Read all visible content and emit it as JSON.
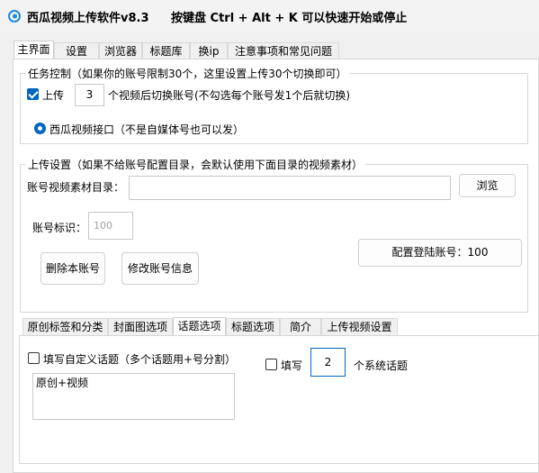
{
  "window": {
    "title": "西瓜视频上传软件v8.3",
    "hotkey_hint": "按键盘 Ctrl + Alt + K  可以快速开始或停止"
  },
  "main_tabs": [
    "主界面",
    "设置",
    "浏览器",
    "标题库",
    "换ip",
    "注意事项和常见问题"
  ],
  "task_control": {
    "title": "任务控制（如果你的账号限制30个，这里设置上传30个切换即可）",
    "upload_checkbox_label": "上传",
    "upload_count": "3",
    "after_text": "个视频后切换账号(不勾选每个账号发1个后就切换)",
    "radio_label": "西瓜视频接口（不是自媒体号也可以发）"
  },
  "upload_settings": {
    "title": "上传设置（如果不给账号配置目录，会默认使用下面目录的视频素材）",
    "dir_label": "账号视频素材目录：",
    "dir_value": "",
    "browse_button": "浏览",
    "account_id_label": "账号标识：",
    "account_id_placeholder": "100",
    "config_button": "配置登陆账号：100",
    "delete_button": "删除本账号",
    "edit_button": "修改账号信息"
  },
  "sub_tabs": [
    "原创标签和分类",
    "封面图选项",
    "话题选项",
    "标题选项",
    "简介",
    "上传视频设置"
  ],
  "topics": {
    "custom_checkbox_label": "填写自定义话题（多个话题用+号分割）",
    "custom_value": "原创+视频",
    "fill_checkbox_label": "填写",
    "fill_count": "2",
    "system_label": "个系统话题"
  },
  "colors": {
    "accent": "#0067c0",
    "border": "#d8d8d8",
    "panel_bg": "#ffffff",
    "window_bg": "#f0f0f0"
  }
}
